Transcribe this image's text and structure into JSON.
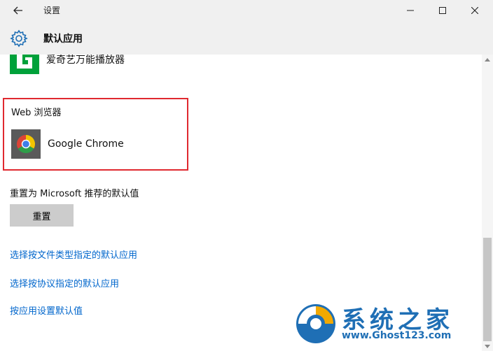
{
  "window": {
    "title": "设置"
  },
  "header": {
    "page_title": "默认应用"
  },
  "apps": {
    "video_player_name": "爱奇艺万能播放器"
  },
  "web_browser": {
    "heading": "Web 浏览器",
    "app_name": "Google Chrome"
  },
  "reset": {
    "heading": "重置为 Microsoft 推荐的默认值",
    "button_label": "重置"
  },
  "links": {
    "by_file_type": "选择按文件类型指定的默认应用",
    "by_protocol": "选择按协议指定的默认应用",
    "by_app": "按应用设置默认值"
  },
  "watermark": {
    "brand": "系统之家",
    "url": "www.Ghost123.com"
  },
  "icons": {
    "back": "back-arrow-icon",
    "minimize": "minimize-icon",
    "maximize": "maximize-icon",
    "close": "close-icon",
    "settings": "gear-icon",
    "video_player": "iqiyi-player-icon",
    "browser": "chrome-icon"
  },
  "colors": {
    "link": "#0066cc",
    "highlight_border": "#e0292f",
    "titlebar": "#f0f0f0"
  }
}
